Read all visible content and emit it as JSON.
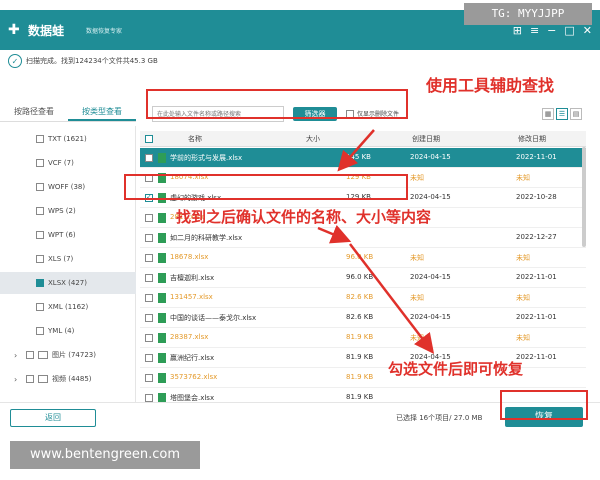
{
  "watermarks": {
    "tg": "TG: MYYJJPP",
    "url": "www.bentengreen.com"
  },
  "titlebar": {
    "app_name": "数据蛙",
    "app_sub": "数据恢复专家",
    "buttons": [
      "⊞",
      "≡",
      "−",
      "□",
      "✕"
    ]
  },
  "scan": {
    "status": "扫描完成。找到124234个文件共45.3 GB"
  },
  "side_tabs": [
    "按路径查看",
    "按类型查看"
  ],
  "sidebar": {
    "items": [
      {
        "label": "TXT (1621)"
      },
      {
        "label": "VCF (7)"
      },
      {
        "label": "WOFF (38)"
      },
      {
        "label": "WPS (2)"
      },
      {
        "label": "WPT (6)"
      },
      {
        "label": "XLS (7)"
      },
      {
        "label": "XLSX (427)"
      },
      {
        "label": "XML (1162)"
      },
      {
        "label": "YML (4)"
      }
    ],
    "folders": [
      {
        "label": "图片 (74723)"
      },
      {
        "label": "视频 (4485)"
      }
    ]
  },
  "search": {
    "placeholder": "在此处输入文件名称或路径搜索",
    "filter_label": "筛选器",
    "deleted_only": "仅显示删除文件"
  },
  "table": {
    "headers": {
      "name": "名称",
      "size": "大小",
      "created": "创建日期",
      "modified": "修改日期"
    },
    "rows": [
      {
        "name": "学前的形式与发展.xlsx",
        "size": "145 KB",
        "created": "2024-04-15",
        "modified": "2022-11-01"
      },
      {
        "name": "18074.xlsx",
        "size": "129 KB",
        "created": "未知",
        "modified": "未知"
      },
      {
        "name": "虚幻的游戏.xlsx",
        "size": "129 KB",
        "created": "2024-04-15",
        "modified": "2022-10-28"
      },
      {
        "name": "2811.xlsx",
        "size": "",
        "created": "",
        "modified": ""
      },
      {
        "name": "如二月的科研教学.xlsx",
        "size": "",
        "created": "",
        "modified": "2022-12-27"
      },
      {
        "name": "18678.xlsx",
        "size": "96.0 KB",
        "created": "未知",
        "modified": "未知"
      },
      {
        "name": "吉檀迦利.xlsx",
        "size": "96.0 KB",
        "created": "2024-04-15",
        "modified": "2022-11-01"
      },
      {
        "name": "131457.xlsx",
        "size": "82.6 KB",
        "created": "未知",
        "modified": "未知"
      },
      {
        "name": "中国的谈话——泰戈尔.xlsx",
        "size": "82.6 KB",
        "created": "2024-04-15",
        "modified": "2022-11-01"
      },
      {
        "name": "28387.xlsx",
        "size": "81.9 KB",
        "created": "未知",
        "modified": "未知"
      },
      {
        "name": "赢洲纪行.xlsx",
        "size": "81.9 KB",
        "created": "2024-04-15",
        "modified": "2022-11-01"
      },
      {
        "name": "3573762.xlsx",
        "size": "81.9 KB",
        "created": "",
        "modified": ""
      },
      {
        "name": "塔图堡会.xlsx",
        "size": "81.9 KB",
        "created": "",
        "modified": ""
      }
    ]
  },
  "annotations": {
    "a1": "使用工具辅助查找",
    "a2": "找到之后确认文件的名称、大小等内容",
    "a3": "勾选文件后即可恢复"
  },
  "footer": {
    "back": "返回",
    "summary": "已选择 16个项目/ 27.0 MB",
    "recover": "恢复"
  },
  "colors": {
    "brand": "#1f8d96",
    "annotation": "#e0312b",
    "unknown_text": "#e49a2b"
  }
}
